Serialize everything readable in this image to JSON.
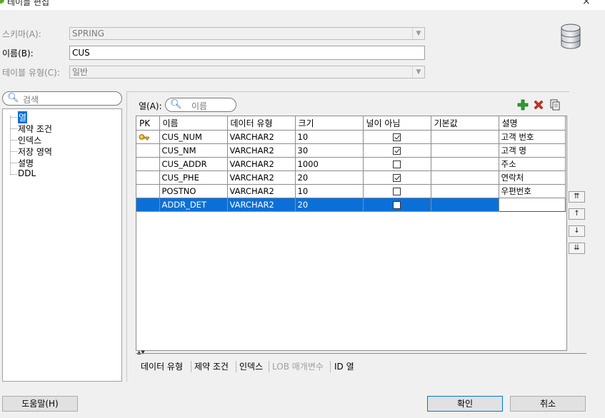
{
  "window": {
    "title": "테이블 편집",
    "close": "×"
  },
  "form": {
    "schema_label": "스키마(A):",
    "schema_value": "SPRING",
    "name_label": "이름(B):",
    "name_value": "CUS",
    "table_type_label": "테이블 유형(C):",
    "table_type_value": "일반"
  },
  "left_search_placeholder": "검색",
  "tree": [
    {
      "label": "열",
      "selected": true
    },
    {
      "label": "제약 조건"
    },
    {
      "label": "인덱스"
    },
    {
      "label": "저장 영역"
    },
    {
      "label": "설명"
    },
    {
      "label": "DDL"
    }
  ],
  "columns_label": "열(A):",
  "columns_search_placeholder": "이름",
  "grid_headers": [
    "PK",
    "이름",
    "데이터 유형",
    "크기",
    "널이 아님",
    "기본값",
    "설명"
  ],
  "grid_rows": [
    {
      "pk": true,
      "name": "CUS_NUM",
      "type": "VARCHAR2",
      "size": "10",
      "not_null": true,
      "default": "",
      "comment": "고객 번호"
    },
    {
      "pk": false,
      "name": "CUS_NM",
      "type": "VARCHAR2",
      "size": "30",
      "not_null": true,
      "default": "",
      "comment": "고객 명"
    },
    {
      "pk": false,
      "name": "CUS_ADDR",
      "type": "VARCHAR2",
      "size": "1000",
      "not_null": false,
      "default": "",
      "comment": "주소"
    },
    {
      "pk": false,
      "name": "CUS_PHE",
      "type": "VARCHAR2",
      "size": "20",
      "not_null": true,
      "default": "",
      "comment": "연락처"
    },
    {
      "pk": false,
      "name": "POSTNO",
      "type": "VARCHAR2",
      "size": "10",
      "not_null": false,
      "default": "",
      "comment": "우편번호"
    },
    {
      "pk": false,
      "name": "ADDR_DET",
      "type": "VARCHAR2",
      "size": "20",
      "not_null": false,
      "default": "",
      "comment": "",
      "selected": true
    }
  ],
  "bottom_tabs": [
    {
      "label": "데이터 유형"
    },
    {
      "label": "제약 조건"
    },
    {
      "label": "인덱스"
    },
    {
      "label": "LOB 매개변수",
      "disabled": true
    },
    {
      "label": "ID 열"
    }
  ],
  "buttons": {
    "help": "도움말(H)",
    "ok": "확인",
    "cancel": "취소"
  },
  "colors": {
    "selection": "#0a70d8",
    "add_icon": "#2e9e2e",
    "delete_icon": "#d62d20",
    "key_icon": "#d9a21b"
  },
  "icons": {
    "add": "plus-icon",
    "delete": "x-icon",
    "copy": "copy-icon",
    "db": "database-icon",
    "key": "key-icon",
    "search": "search-icon"
  }
}
